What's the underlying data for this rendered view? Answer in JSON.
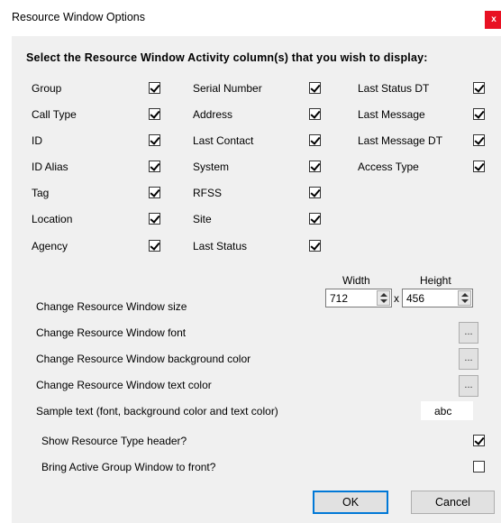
{
  "window": {
    "title": "Resource Window Options",
    "close_label": "x"
  },
  "heading": "Select the Resource Window Activity column(s) that you wish to display:",
  "columns": [
    {
      "label": "Group",
      "checked": true
    },
    {
      "label": "Call Type",
      "checked": true
    },
    {
      "label": "ID",
      "checked": true
    },
    {
      "label": "ID Alias",
      "checked": true
    },
    {
      "label": "Tag",
      "checked": true
    },
    {
      "label": "Location",
      "checked": true
    },
    {
      "label": "Agency",
      "checked": true
    },
    {
      "label": "Serial Number",
      "checked": true
    },
    {
      "label": "Address",
      "checked": true
    },
    {
      "label": "Last Contact",
      "checked": true
    },
    {
      "label": "System",
      "checked": true
    },
    {
      "label": "RFSS",
      "checked": true
    },
    {
      "label": "Site",
      "checked": true
    },
    {
      "label": "Last Status",
      "checked": true
    },
    {
      "label": "Last Status DT",
      "checked": true
    },
    {
      "label": "Last Message",
      "checked": true
    },
    {
      "label": "Last Message DT",
      "checked": true
    },
    {
      "label": "Access Type",
      "checked": true
    }
  ],
  "size": {
    "label": "Change Resource Window size",
    "width_label": "Width",
    "height_label": "Height",
    "width_value": "712",
    "height_value": "456",
    "separator": "x"
  },
  "font": {
    "label": "Change Resource Window font",
    "button": "..."
  },
  "background": {
    "label": "Change Resource Window background color",
    "button": "..."
  },
  "text_color": {
    "label": "Change Resource Window text color",
    "button": "..."
  },
  "sample": {
    "label": "Sample text (font, background color and text color)",
    "value": "abc"
  },
  "show_header": {
    "label": "Show Resource Type header?",
    "checked": true
  },
  "bring_front": {
    "label": "Bring Active Group Window to front?",
    "checked": false
  },
  "buttons": {
    "ok": "OK",
    "cancel": "Cancel"
  }
}
